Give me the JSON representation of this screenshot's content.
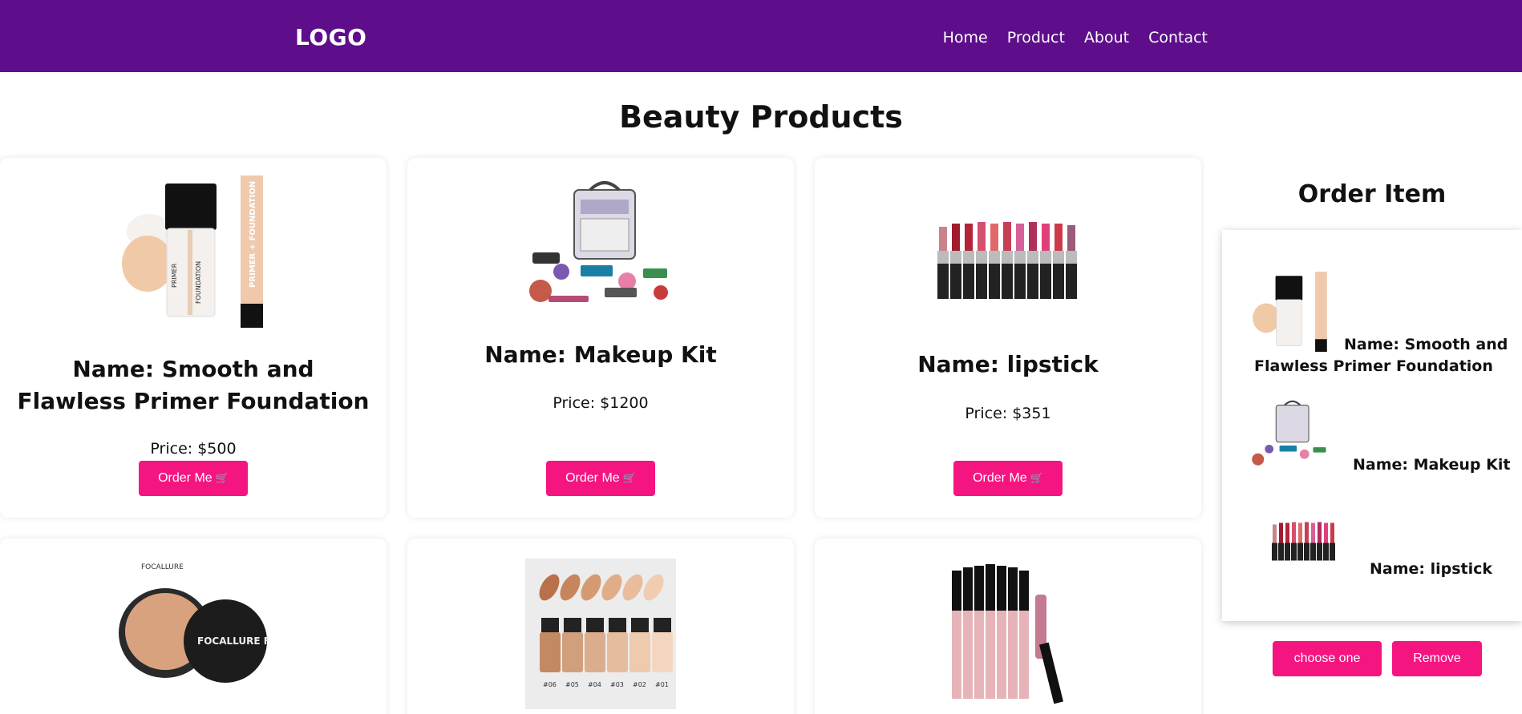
{
  "header": {
    "logo": "LOGO",
    "nav": [
      "Home",
      "Product",
      "About",
      "Contact"
    ]
  },
  "page_title": "Beauty Products",
  "products": [
    {
      "name": "Name: Smooth and Flawless Primer Foundation",
      "price": "Price: $500",
      "button": "Order Me"
    },
    {
      "name": "Name: Makeup Kit",
      "price": "Price: $1200",
      "button": "Order Me"
    },
    {
      "name": "Name: lipstick",
      "price": "Price: $351",
      "button": "Order Me"
    }
  ],
  "product_images": {
    "primer_text_1": "PRIMER",
    "primer_text_2": "FOUNDATION",
    "primer_box_text": "PRIMER + FOUNDATION",
    "compact_brand": "FOCALLURE",
    "compact_label": "FOCALLURE FACE",
    "shade_labels": [
      "#06",
      "#05",
      "#04",
      "#03",
      "#02",
      "#01"
    ]
  },
  "order": {
    "title": "Order Item",
    "items": [
      {
        "name": "Name: Smooth and Flawless Primer Foundation"
      },
      {
        "name": "Name: Makeup Kit"
      },
      {
        "name": "Name: lipstick"
      }
    ],
    "choose_label": "choose one",
    "remove_label": "Remove"
  },
  "colors": {
    "header_bg": "#5e0e8b",
    "button_bg": "#f51581"
  },
  "icons": {
    "cart": "shopping-cart-icon"
  }
}
